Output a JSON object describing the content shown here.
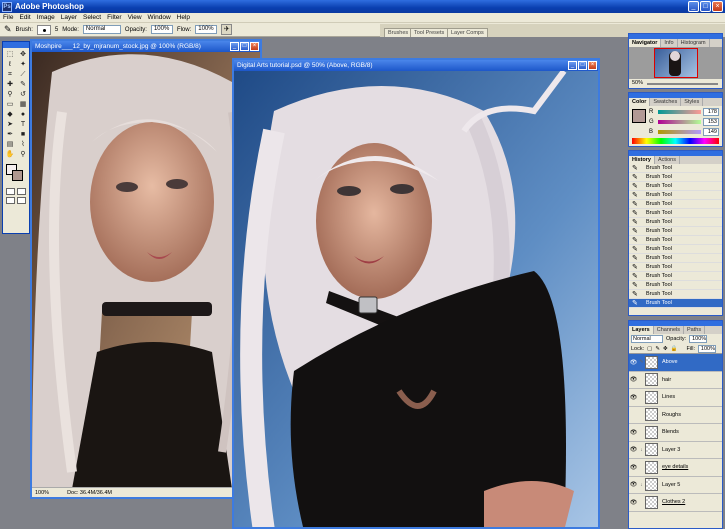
{
  "app": {
    "title": "Adobe Photoshop"
  },
  "menu": [
    "File",
    "Edit",
    "Image",
    "Layer",
    "Select",
    "Filter",
    "View",
    "Window",
    "Help"
  ],
  "options": {
    "brush_label": "Brush:",
    "brush_size": "5",
    "mode_label": "Mode:",
    "mode_value": "Normal",
    "opacity_label": "Opacity:",
    "opacity_value": "100%",
    "flow_label": "Flow:",
    "flow_value": "100%"
  },
  "palette_well": [
    "Brushes",
    "Tool Presets",
    "Layer Comps"
  ],
  "doc_reference": {
    "title": "Moshpire___12_by_mjranum_stock.jpg @ 100% (RGB/8)",
    "zoom": "100%",
    "doc_info": "Doc: 36.4M/36.4M"
  },
  "doc_main": {
    "title": "Digital Arts tutorial.psd @ 50% (Above, RGB/8)"
  },
  "navigator": {
    "tabs": [
      "Navigator",
      "Info",
      "Histogram"
    ],
    "zoom": "50%"
  },
  "color": {
    "tabs": [
      "Color",
      "Swatches",
      "Styles"
    ],
    "channels": [
      {
        "name": "R",
        "value": "178"
      },
      {
        "name": "G",
        "value": "153"
      },
      {
        "name": "B",
        "value": "149"
      }
    ],
    "fg": "#b29995"
  },
  "history": {
    "tabs": [
      "History",
      "Actions"
    ],
    "items": [
      "Brush Tool",
      "Brush Tool",
      "Brush Tool",
      "Brush Tool",
      "Brush Tool",
      "Brush Tool",
      "Brush Tool",
      "Brush Tool",
      "Brush Tool",
      "Brush Tool",
      "Brush Tool",
      "Brush Tool",
      "Brush Tool",
      "Brush Tool",
      "Brush Tool",
      "Brush Tool"
    ]
  },
  "layers": {
    "tabs": [
      "Layers",
      "Channels",
      "Paths"
    ],
    "blend_mode": "Normal",
    "opacity_label": "Opacity:",
    "opacity_value": "100%",
    "lock_label": "Lock:",
    "fill_label": "Fill:",
    "fill_value": "100%",
    "items": [
      {
        "name": "Above",
        "active": true
      },
      {
        "name": "hair"
      },
      {
        "name": "Lines"
      },
      {
        "name": "Roughs"
      },
      {
        "name": "Blends"
      },
      {
        "name": "Layer 3"
      },
      {
        "name": "eye details"
      },
      {
        "name": "Layer 5"
      },
      {
        "name": "Clothes 2"
      }
    ]
  }
}
